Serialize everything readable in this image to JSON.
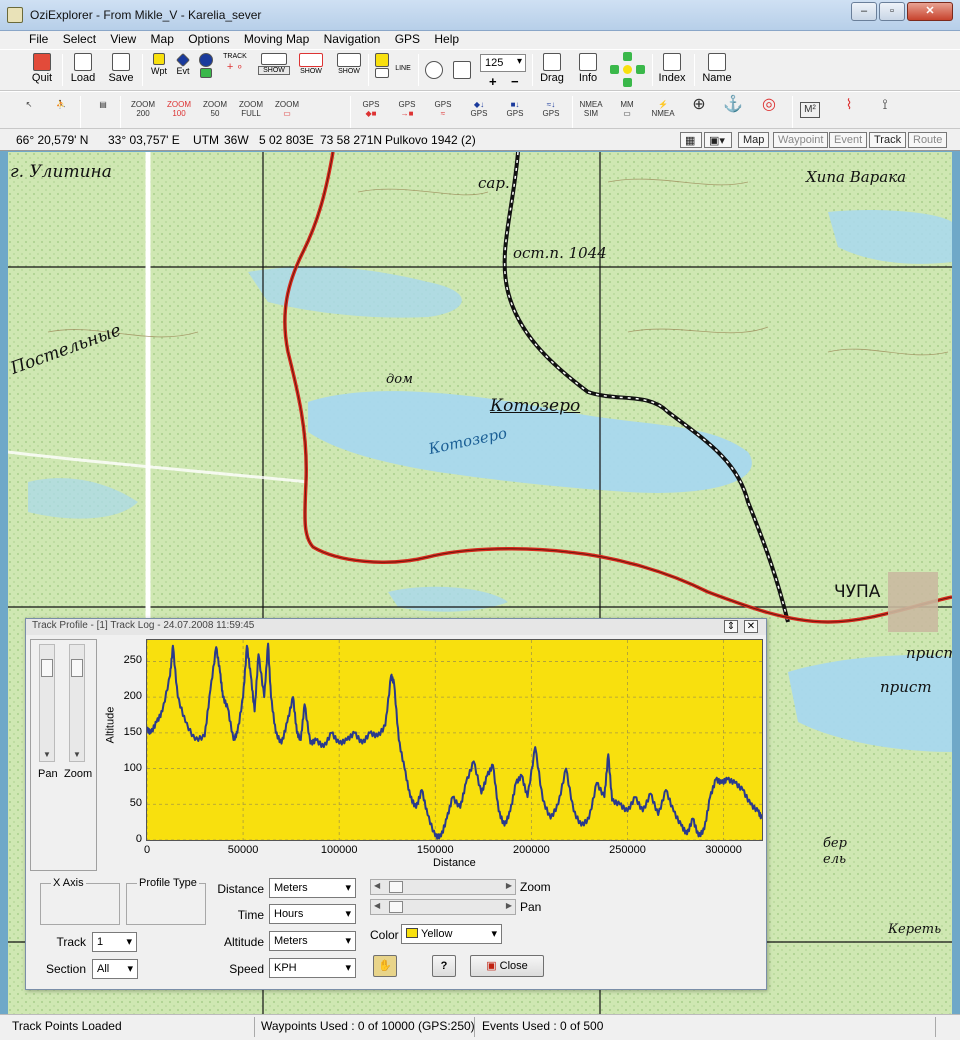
{
  "window": {
    "title": "OziExplorer - From Mikle_V - Karelia_sever"
  },
  "menu": [
    "File",
    "Select",
    "View",
    "Map",
    "Options",
    "Moving Map",
    "Navigation",
    "GPS",
    "Help"
  ],
  "toolbar": {
    "quit": "Quit",
    "load": "Load",
    "save": "Save",
    "wpt": "Wpt",
    "evt": "Evt",
    "track": "TRACK",
    "show": "SHOW",
    "zoom_value": "125",
    "drag": "Drag",
    "info": "Info",
    "index": "Index",
    "name": "Name",
    "plus": "+",
    "minus": "−"
  },
  "toolbar2": {
    "zoom_labels": [
      {
        "top": "ZOOM",
        "bottom": "200"
      },
      {
        "top": "ZOOM",
        "bottom": "100"
      },
      {
        "top": "ZOOM",
        "bottom": "50"
      },
      {
        "top": "ZOOM",
        "bottom": "FULL"
      },
      {
        "top": "ZOOM",
        "bottom": ""
      }
    ],
    "gps_label": "GPS",
    "nmea_sim": {
      "top": "NMEA",
      "bottom": "SIM"
    },
    "mm": "MM",
    "nmea": "NMEA",
    "m2": "M²"
  },
  "coords": {
    "lat": "66° 20,579' N",
    "lon": "33° 03,757' E",
    "utm": "UTM",
    "zone": "36W",
    "easting": "5 02 803E",
    "northing": "73 58 271N",
    "datum": "Pulkovo 1942 (2)",
    "filters": [
      "Map",
      "Waypoint",
      "Event",
      "Track",
      "Route"
    ]
  },
  "map": {
    "labels": [
      "г. Улитина",
      "сар.",
      "ост.п. 1044",
      "Хипа Варака",
      "Постельные",
      "дом",
      "Котозеро",
      "Котозеро",
      "ЧУПА",
      "прист",
      "прист",
      "бер",
      "ель",
      "Кереть"
    ]
  },
  "profile": {
    "title": "Track Profile - [1] Track Log - 24.07.2008 11:59:45",
    "pan_label": "Pan",
    "zoom_label": "Zoom",
    "x_axis_group": "X Axis",
    "profile_type_group": "Profile Type",
    "distance_label": "Distance",
    "distance_value": "Meters",
    "time_label": "Time",
    "time_value": "Hours",
    "altitude_label": "Altitude",
    "altitude_value": "Meters",
    "speed_label": "Speed",
    "speed_value": "KPH",
    "track_label": "Track",
    "track_value": "1",
    "section_label": "Section",
    "section_value": "All",
    "zoom_slider_label": "Zoom",
    "pan_slider_label": "Pan",
    "color_label": "Color",
    "color_value": "Yellow",
    "help_button": "?",
    "close_button": "Close"
  },
  "chart_data": {
    "type": "line",
    "title": "",
    "xlabel": "Distance",
    "ylabel": "Altitude",
    "xlim": [
      0,
      320000
    ],
    "ylim": [
      0,
      280
    ],
    "xticks": [
      0,
      50000,
      100000,
      150000,
      200000,
      250000,
      300000
    ],
    "yticks": [
      0,
      50,
      100,
      150,
      200,
      250
    ],
    "background": "#f8e00e",
    "line_color": "#2a3a8c",
    "grid": true,
    "series": [
      {
        "x": [
          0,
          2000,
          5000,
          8000,
          12000,
          13500,
          16000,
          20000,
          25000,
          30000,
          33000,
          36000,
          38000,
          39500,
          42000,
          45000,
          47000,
          50000,
          52000,
          54000,
          56000,
          58000,
          61000,
          63000,
          64500,
          67000,
          70000,
          73000,
          76000,
          78000,
          80000,
          82000,
          85000,
          88000,
          92000,
          96000,
          100000,
          104000,
          108000,
          112000,
          116000,
          120000,
          124000,
          127000,
          128500,
          131000,
          134000,
          137000,
          140000,
          143000,
          146000,
          150000,
          153000,
          156000,
          159000,
          163000,
          166000,
          170000,
          174000,
          177000,
          180000,
          183000,
          186000,
          189000,
          192000,
          195000,
          198000,
          202000,
          206000,
          210000,
          214000,
          218000,
          222000,
          226000,
          230000,
          234000,
          238000,
          240000,
          242000,
          246000,
          250000,
          254000,
          258000,
          262000,
          266000,
          270000,
          274000,
          278000,
          281000,
          284000,
          287000,
          290000,
          293000,
          296000,
          299000,
          302000,
          306000,
          310000,
          314000,
          318000,
          320000
        ],
        "y": [
          155,
          150,
          165,
          180,
          230,
          272,
          200,
          165,
          140,
          145,
          210,
          270,
          235,
          200,
          185,
          140,
          150,
          200,
          272,
          230,
          180,
          260,
          200,
          275,
          200,
          150,
          135,
          165,
          200,
          150,
          140,
          190,
          135,
          140,
          130,
          150,
          135,
          140,
          150,
          135,
          150,
          145,
          160,
          230,
          220,
          140,
          100,
          60,
          45,
          70,
          35,
          5,
          5,
          30,
          60,
          45,
          80,
          110,
          65,
          90,
          105,
          40,
          20,
          40,
          80,
          90,
          60,
          130,
          55,
          30,
          50,
          100,
          40,
          20,
          30,
          80,
          60,
          120,
          55,
          50,
          40,
          60,
          40,
          65,
          35,
          70,
          40,
          20,
          8,
          30,
          5,
          15,
          60,
          85,
          80,
          85,
          80,
          70,
          50,
          40,
          30
        ]
      }
    ]
  },
  "status": {
    "left": "Track Points Loaded",
    "waypoints": "Waypoints Used : 0 of 10000  (GPS:250)",
    "events": "Events Used : 0 of 500"
  }
}
